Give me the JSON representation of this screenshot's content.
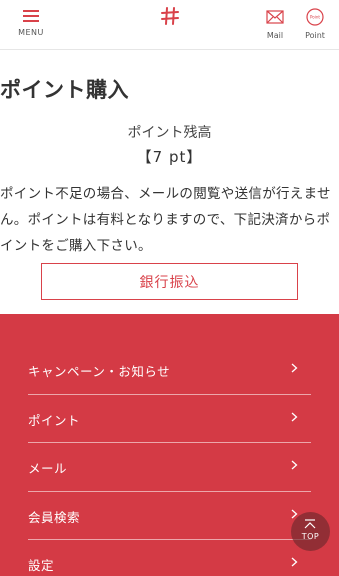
{
  "header": {
    "menu_label": "MENU",
    "logo_icon": "hash-icon",
    "mail_label": "Mail",
    "point_label": "Point",
    "point_icon_text": "Point",
    "accent_color": "#d9424a"
  },
  "main": {
    "title": "ポイント購入",
    "balance_label": "ポイント残高",
    "balance_value": "【7   pt】",
    "description": "ポイント不足の場合、メールの閲覧や送信が行えません。ポイントは有料となりますので、下記決済からポイントをご購入下さい。",
    "bank_transfer_label": "銀行振込"
  },
  "footer": {
    "background_color": "#d43a45",
    "items": [
      {
        "label": "キャンペーン・お知らせ"
      },
      {
        "label": "ポイント"
      },
      {
        "label": "メール"
      },
      {
        "label": "会員検索"
      },
      {
        "label": "設定"
      }
    ],
    "top_label": "TOP"
  }
}
